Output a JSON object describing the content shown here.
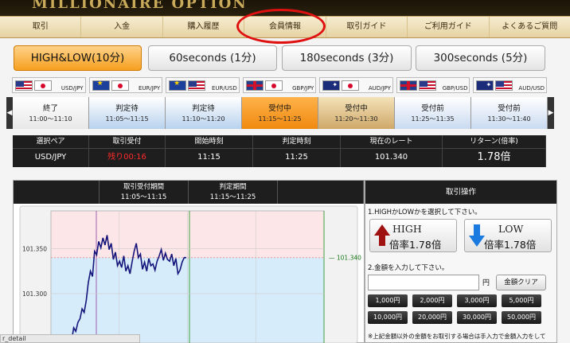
{
  "header": {
    "logo_text": "MILLIONAIRE OPTION"
  },
  "nav": {
    "items": [
      "取引",
      "入金",
      "購入履歴",
      "会員情報",
      "取引ガイド",
      "ご利用ガイド",
      "よくあるご質問"
    ],
    "highlight_color": "#e01010"
  },
  "modes": [
    {
      "label": "HIGH&LOW(10分)",
      "active": true
    },
    {
      "label": "60seconds (1分)",
      "active": false
    },
    {
      "label": "180seconds (3分)",
      "active": false
    },
    {
      "label": "300seconds (5分)",
      "active": false
    }
  ],
  "pairs": [
    {
      "label": "USD/JPY",
      "flags": [
        "flag-us",
        "flag-jp"
      ]
    },
    {
      "label": "EUR/JPY",
      "flags": [
        "flag-eu",
        "flag-jp"
      ]
    },
    {
      "label": "EUR/USD",
      "flags": [
        "flag-eu",
        "flag-us"
      ]
    },
    {
      "label": "GBP/JPY",
      "flags": [
        "flag-gb",
        "flag-jp"
      ]
    },
    {
      "label": "AUD/JPY",
      "flags": [
        "flag-au",
        "flag-jp"
      ]
    },
    {
      "label": "GBP/USD",
      "flags": [
        "flag-gb",
        "flag-us"
      ]
    },
    {
      "label": "AUD/USD",
      "flags": [
        "flag-au",
        "flag-us"
      ]
    }
  ],
  "slots": [
    {
      "status": "終了",
      "time": "11:00～11:10",
      "kind": "ended"
    },
    {
      "status": "判定待",
      "time": "11:05～11:15",
      "kind": "waiting"
    },
    {
      "status": "判定待",
      "time": "11:10～11:20",
      "kind": "waiting"
    },
    {
      "status": "受付中",
      "time": "11:15～11:25",
      "kind": "current"
    },
    {
      "status": "受付中",
      "time": "11:20～11:30",
      "kind": "next"
    },
    {
      "status": "受付前",
      "time": "11:25～11:35",
      "kind": "before"
    },
    {
      "status": "受付前",
      "time": "11:30～11:40",
      "kind": "before"
    }
  ],
  "info": {
    "headers": [
      "選択ペア",
      "取引受付",
      "開始時刻",
      "判定時刻",
      "現在のレート",
      "リターン(倍率)"
    ],
    "values": [
      "USD/JPY",
      "残り00:16",
      "11:15",
      "11:25",
      "101.340",
      "1.78倍"
    ]
  },
  "chart_panel": {
    "head_cols": [
      {
        "l1": "",
        "l2": ""
      },
      {
        "l1": "取引受付期間",
        "l2": "11:05～11:15"
      },
      {
        "l1": "判定期間",
        "l2": "11:15～11:25"
      },
      {
        "l1": "",
        "l2": ""
      }
    ]
  },
  "chart_data": {
    "type": "line",
    "title": "",
    "xlabel": "",
    "ylabel": "",
    "yticks": [
      "101.350",
      "101.300"
    ],
    "ylim": [
      101.245,
      101.392
    ],
    "current_label": "101.340",
    "current_rate": 101.34,
    "series": [
      {
        "name": "",
        "color": "#14147a",
        "x": [
          0,
          1,
          2,
          3,
          4,
          5,
          6,
          7,
          8,
          9,
          10,
          11,
          12,
          13,
          14,
          15,
          16,
          17,
          18,
          19,
          20,
          21,
          22,
          23,
          24,
          25,
          26,
          27,
          28,
          29,
          30,
          31,
          32,
          33,
          34,
          35,
          36,
          37,
          38,
          39,
          40,
          41,
          42,
          43,
          44,
          45,
          46,
          47,
          48,
          49,
          50,
          51,
          52,
          53,
          54,
          55
        ],
        "values": [
          101.248,
          101.262,
          101.258,
          101.268,
          101.272,
          101.283,
          101.279,
          101.292,
          101.312,
          101.325,
          101.319,
          101.347,
          101.343,
          101.358,
          101.351,
          101.362,
          101.354,
          101.365,
          101.349,
          101.356,
          101.338,
          101.346,
          101.331,
          101.336,
          101.329,
          101.342,
          101.325,
          101.331,
          101.322,
          101.335,
          101.347,
          101.356,
          101.34,
          101.344,
          101.327,
          101.335,
          101.325,
          101.339,
          101.331,
          101.333,
          101.326,
          101.336,
          101.342,
          101.349,
          101.337,
          101.345,
          101.338,
          101.336,
          101.344,
          101.331,
          101.339,
          101.322,
          101.326,
          101.335,
          101.34,
          101.34
        ]
      }
    ],
    "zones": {
      "pink_above": 101.34,
      "blue_below": 101.34
    }
  },
  "order": {
    "title": "取引操作",
    "step1": "1.HIGHかLOWかを選択して下さい。",
    "high": {
      "label": "HIGH",
      "rate": "倍率1.78倍"
    },
    "low": {
      "label": "LOW",
      "rate": "倍率1.78倍"
    },
    "step2": "2.金額を入力して下さい。",
    "amount_value": "",
    "yen": "円",
    "clear_label": "金額クリア",
    "amounts": [
      "1,000円",
      "2,000円",
      "3,000円",
      "5,000円",
      "10,000円",
      "20,000円",
      "30,000円",
      "50,000円"
    ],
    "note": "※上記金額以外の金額をお取引する場合は手入力で金額入力をして"
  },
  "status_bar": {
    "text": "r_detail"
  }
}
